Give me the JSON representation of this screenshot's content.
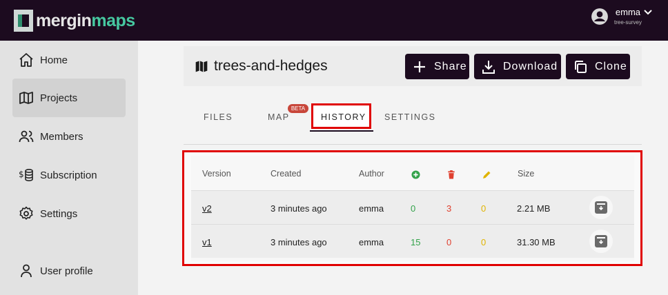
{
  "brand": {
    "part1": "mergin",
    "part2": "maps"
  },
  "user": {
    "name": "emma",
    "workspace": "tree-survey"
  },
  "sidebar": {
    "items": [
      {
        "label": "Home",
        "icon": "home-icon"
      },
      {
        "label": "Projects",
        "icon": "map-icon",
        "active": true
      },
      {
        "label": "Members",
        "icon": "members-icon"
      },
      {
        "label": "Subscription",
        "icon": "coins-icon"
      },
      {
        "label": "Settings",
        "icon": "gear-icon"
      },
      {
        "label": "User profile",
        "icon": "user-icon"
      }
    ]
  },
  "project": {
    "title": "trees-and-hedges",
    "buttons": {
      "share": "Share",
      "download": "Download",
      "clone": "Clone"
    }
  },
  "tabs": {
    "files": "FILES",
    "map": "MAP",
    "map_badge": "BETA",
    "history": "HISTORY",
    "settings": "SETTINGS",
    "active": "history"
  },
  "history": {
    "columns": {
      "version": "Version",
      "created": "Created",
      "author": "Author",
      "added": "plus-circle-icon",
      "removed": "trash-icon",
      "updated": "pencil-icon",
      "size": "Size"
    },
    "rows": [
      {
        "version": "v2",
        "created": "3 minutes ago",
        "author": "emma",
        "added": "0",
        "removed": "3",
        "updated": "0",
        "size": "2.21 MB"
      },
      {
        "version": "v1",
        "created": "3 minutes ago",
        "author": "emma",
        "added": "15",
        "removed": "0",
        "updated": "0",
        "size": "31.30 MB"
      }
    ]
  },
  "colors": {
    "brand_dark": "#1c0b1f",
    "brand_green": "#46c8a0",
    "highlight": "#e00000",
    "added": "#33a24a",
    "removed": "#e0402f",
    "updated": "#e0b400"
  }
}
